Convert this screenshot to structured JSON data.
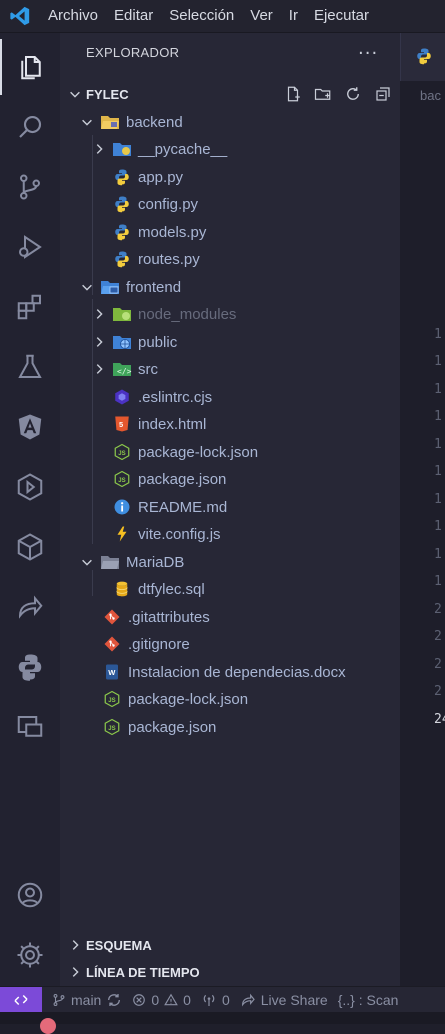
{
  "menu": [
    "Archivo",
    "Editar",
    "Selección",
    "Ver",
    "Ir",
    "Ejecutar"
  ],
  "explorer": {
    "title": "EXPLORADOR",
    "more": "···",
    "root": "FYLEC",
    "tree": [
      {
        "label": "backend",
        "type": "folder-open",
        "icon": "folder-backend-icon"
      },
      {
        "label": "__pycache__",
        "type": "folder-closed",
        "icon": "folder-pycache-icon"
      },
      {
        "label": "app.py",
        "type": "file",
        "icon": "python-icon"
      },
      {
        "label": "config.py",
        "type": "file",
        "icon": "python-icon"
      },
      {
        "label": "models.py",
        "type": "file",
        "icon": "python-icon"
      },
      {
        "label": "routes.py",
        "type": "file",
        "icon": "python-icon"
      },
      {
        "label": "frontend",
        "type": "folder-open",
        "icon": "folder-frontend-icon"
      },
      {
        "label": "node_modules",
        "type": "folder-closed",
        "icon": "folder-node-icon"
      },
      {
        "label": "public",
        "type": "folder-closed",
        "icon": "folder-public-icon"
      },
      {
        "label": "src",
        "type": "folder-closed",
        "icon": "folder-src-icon"
      },
      {
        "label": ".eslintrc.cjs",
        "type": "file",
        "icon": "eslint-icon"
      },
      {
        "label": "index.html",
        "type": "file",
        "icon": "html-icon"
      },
      {
        "label": "package-lock.json",
        "type": "file",
        "icon": "nodejs-icon"
      },
      {
        "label": "package.json",
        "type": "file",
        "icon": "nodejs-icon"
      },
      {
        "label": "README.md",
        "type": "file",
        "icon": "info-icon"
      },
      {
        "label": "vite.config.js",
        "type": "file",
        "icon": "vite-icon"
      },
      {
        "label": "MariaDB",
        "type": "folder-open",
        "icon": "folder-icon"
      },
      {
        "label": "dtfylec.sql",
        "type": "file",
        "icon": "database-icon"
      },
      {
        "label": ".gitattributes",
        "type": "file",
        "icon": "git-icon"
      },
      {
        "label": ".gitignore",
        "type": "file",
        "icon": "git-icon"
      },
      {
        "label": "Instalacion de dependecias.docx",
        "type": "file",
        "icon": "word-icon"
      },
      {
        "label": "package-lock.json",
        "type": "file",
        "icon": "nodejs-icon"
      },
      {
        "label": "package.json",
        "type": "file",
        "icon": "nodejs-icon"
      }
    ]
  },
  "bottom_sections": [
    "ESQUEMA",
    "LÍNEA DE TIEMPO"
  ],
  "editor": {
    "breadcrumb": "bac",
    "line_numbers": [
      "1",
      "1",
      "1",
      "1",
      "1",
      "1",
      "1",
      "1",
      "1",
      "1",
      "2",
      "2",
      "2",
      "2",
      "24"
    ]
  },
  "statusbar": {
    "branch": "main",
    "errors": "0",
    "warnings": "0",
    "ports": "0",
    "live_share": "Live Share",
    "scan": "{..} : Scan"
  },
  "colors": {
    "accent": "#7c4ad8",
    "python": "#3f7fc7",
    "git": "#e0553c",
    "node": "#8cc84b"
  }
}
